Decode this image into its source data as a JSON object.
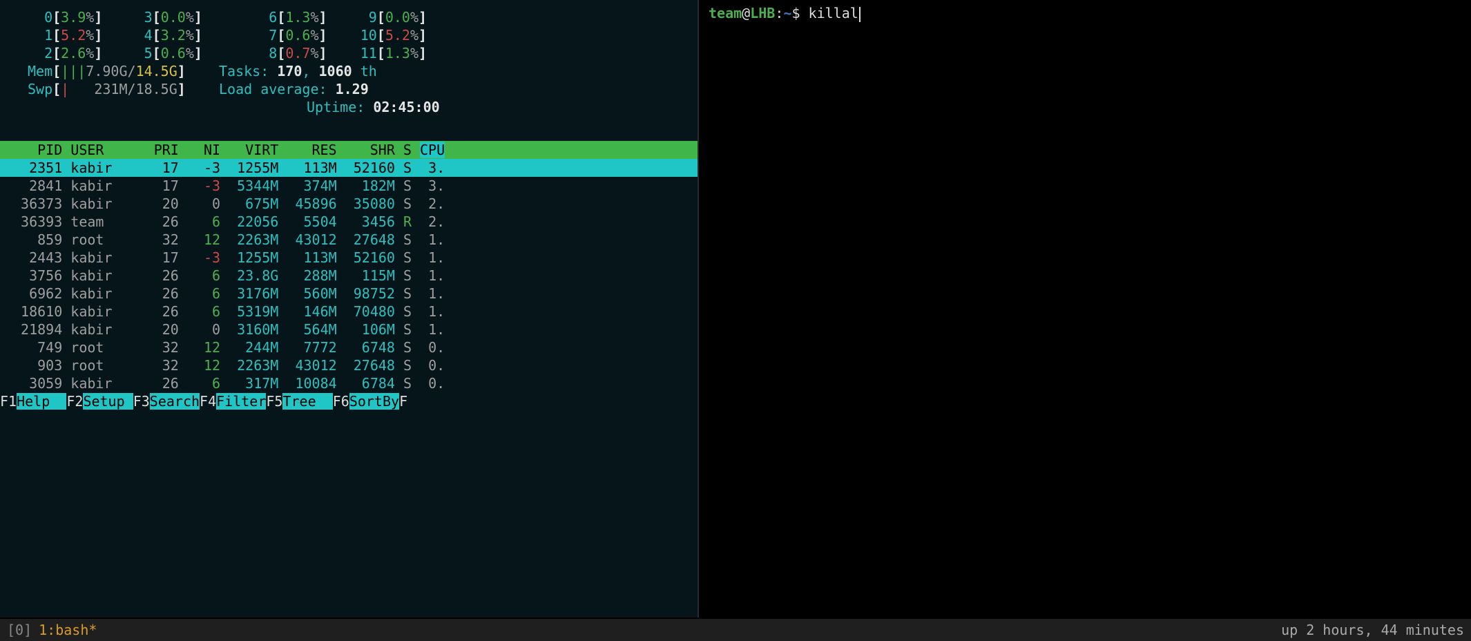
{
  "meters": {
    "rows": [
      [
        {
          "idx": "0",
          "val": "3.9",
          "color": "green"
        },
        {
          "idx": "3",
          "val": "0.0",
          "color": "green"
        },
        {
          "idx": "6",
          "val": "1.3",
          "color": "green"
        },
        {
          "idx": "9",
          "val": "0.0",
          "color": "green"
        }
      ],
      [
        {
          "idx": "1",
          "val": "5.2",
          "color": "red"
        },
        {
          "idx": "4",
          "val": "3.2",
          "color": "green"
        },
        {
          "idx": "7",
          "val": "0.6",
          "color": "green"
        },
        {
          "idx": "10",
          "val": "5.2",
          "color": "red"
        }
      ],
      [
        {
          "idx": "2",
          "val": "2.6",
          "color": "green"
        },
        {
          "idx": "5",
          "val": "0.6",
          "color": "green"
        },
        {
          "idx": "8",
          "val": "0.7",
          "color": "red"
        },
        {
          "idx": "11",
          "val": "1.3",
          "color": "green"
        }
      ]
    ],
    "mem": {
      "label": "Mem",
      "bars": "|||",
      "used": "7.90G",
      "total": "14.5G"
    },
    "swp": {
      "label": "Swp",
      "bars": "|",
      "used": "231M",
      "total": "18.5G"
    },
    "tasks_label": "Tasks: ",
    "tasks": "170",
    "threads": "1060",
    "threads_suffix": " th",
    "load_label": "Load average: ",
    "load": "1.29",
    "uptime_label": "Uptime: ",
    "uptime": "02:45:00"
  },
  "table": {
    "headers": [
      "PID",
      "USER",
      "PRI",
      "NI",
      "VIRT",
      "RES",
      "SHR",
      "S",
      "CPU"
    ],
    "rows": [
      {
        "pid": "2351",
        "user": "kabir",
        "pri": "17",
        "ni": "-3",
        "ni_color": "",
        "virt": "1255M",
        "res": "113M",
        "shr": "52160",
        "s": "S",
        "cpu": "3.",
        "sel": true
      },
      {
        "pid": "2841",
        "user": "kabir",
        "pri": "17",
        "ni": "-3",
        "ni_color": "red",
        "virt": "5344M",
        "res": "374M",
        "shr": "182M",
        "s": "S",
        "cpu": "3."
      },
      {
        "pid": "36373",
        "user": "kabir",
        "pri": "20",
        "ni": "0",
        "ni_color": "",
        "virt": "675M",
        "res": "45896",
        "shr": "35080",
        "s": "S",
        "cpu": "2."
      },
      {
        "pid": "36393",
        "user": "team",
        "pri": "26",
        "ni": "6",
        "ni_color": "green",
        "virt": "22056",
        "res": "5504",
        "shr": "3456",
        "s": "R",
        "s_color": "green",
        "cpu": "2."
      },
      {
        "pid": "859",
        "user": "root",
        "pri": "32",
        "ni": "12",
        "ni_color": "green",
        "virt": "2263M",
        "res": "43012",
        "shr": "27648",
        "s": "S",
        "cpu": "1."
      },
      {
        "pid": "2443",
        "user": "kabir",
        "pri": "17",
        "ni": "-3",
        "ni_color": "red",
        "virt": "1255M",
        "res": "113M",
        "shr": "52160",
        "s": "S",
        "cpu": "1."
      },
      {
        "pid": "3756",
        "user": "kabir",
        "pri": "26",
        "ni": "6",
        "ni_color": "green",
        "virt": "23.8G",
        "res": "288M",
        "shr": "115M",
        "s": "S",
        "cpu": "1."
      },
      {
        "pid": "6962",
        "user": "kabir",
        "pri": "26",
        "ni": "6",
        "ni_color": "green",
        "virt": "3176M",
        "res": "560M",
        "shr": "98752",
        "s": "S",
        "cpu": "1."
      },
      {
        "pid": "18610",
        "user": "kabir",
        "pri": "26",
        "ni": "6",
        "ni_color": "green",
        "virt": "5319M",
        "res": "146M",
        "shr": "70480",
        "s": "S",
        "cpu": "1."
      },
      {
        "pid": "21894",
        "user": "kabir",
        "pri": "20",
        "ni": "0",
        "ni_color": "",
        "virt": "3160M",
        "res": "564M",
        "shr": "106M",
        "s": "S",
        "cpu": "1."
      },
      {
        "pid": "749",
        "user": "root",
        "pri": "32",
        "ni": "12",
        "ni_color": "green",
        "virt": "244M",
        "res": "7772",
        "shr": "6748",
        "s": "S",
        "cpu": "0."
      },
      {
        "pid": "903",
        "user": "root",
        "pri": "32",
        "ni": "12",
        "ni_color": "green",
        "virt": "2263M",
        "res": "43012",
        "shr": "27648",
        "s": "S",
        "cpu": "0."
      },
      {
        "pid": "3059",
        "user": "kabir",
        "pri": "26",
        "ni": "6",
        "ni_color": "green",
        "virt": "317M",
        "res": "10084",
        "shr": "6784",
        "s": "S",
        "cpu": "0."
      }
    ]
  },
  "fkeys": [
    {
      "k": "F1",
      "l": "Help  "
    },
    {
      "k": "F2",
      "l": "Setup "
    },
    {
      "k": "F3",
      "l": "Search"
    },
    {
      "k": "F4",
      "l": "Filter"
    },
    {
      "k": "F5",
      "l": "Tree  "
    },
    {
      "k": "F6",
      "l": "SortBy"
    },
    {
      "k": "F",
      "l": ""
    }
  ],
  "status": {
    "session": "[0]",
    "window": "1:bash*",
    "uptime": "up 2 hours, 44 minutes"
  },
  "shell": {
    "user": "team",
    "host": "LHB",
    "path": "~",
    "sep1": "@",
    "sep2": ":",
    "prompt": "$",
    "typed": "killal"
  }
}
